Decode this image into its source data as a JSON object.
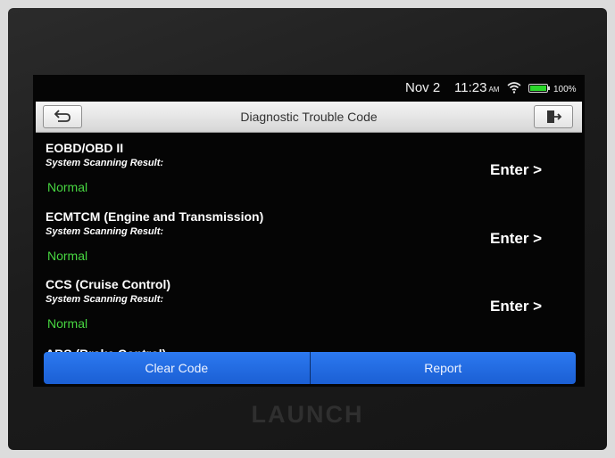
{
  "status_bar": {
    "date": "Nov 2",
    "time": "11:23",
    "ampm": "AM",
    "battery": "100%",
    "battery_level": 1.0,
    "battery_color": "#2bd82b",
    "wifi_icon": "wifi-icon"
  },
  "header": {
    "title": "Diagnostic Trouble Code",
    "back_icon": "back-arrow-icon",
    "exit_icon": "exit-icon"
  },
  "systems": [
    {
      "name": "EOBD/OBD II",
      "label": "System Scanning Result:",
      "status": "Normal",
      "action": "Enter >"
    },
    {
      "name": "ECMTCM (Engine and Transmission)",
      "label": "System Scanning Result:",
      "status": "Normal",
      "action": "Enter >"
    },
    {
      "name": "CCS (Cruise Control)",
      "label": "System Scanning Result:",
      "status": "Normal",
      "action": "Enter >"
    },
    {
      "name": "ABS (Brake Control)"
    }
  ],
  "footer": {
    "clear_code": "Clear Code",
    "report": "Report"
  },
  "device": {
    "brand": "LAUNCH"
  },
  "colors": {
    "status_normal": "#47d641",
    "button_blue": "#2c79f0"
  }
}
